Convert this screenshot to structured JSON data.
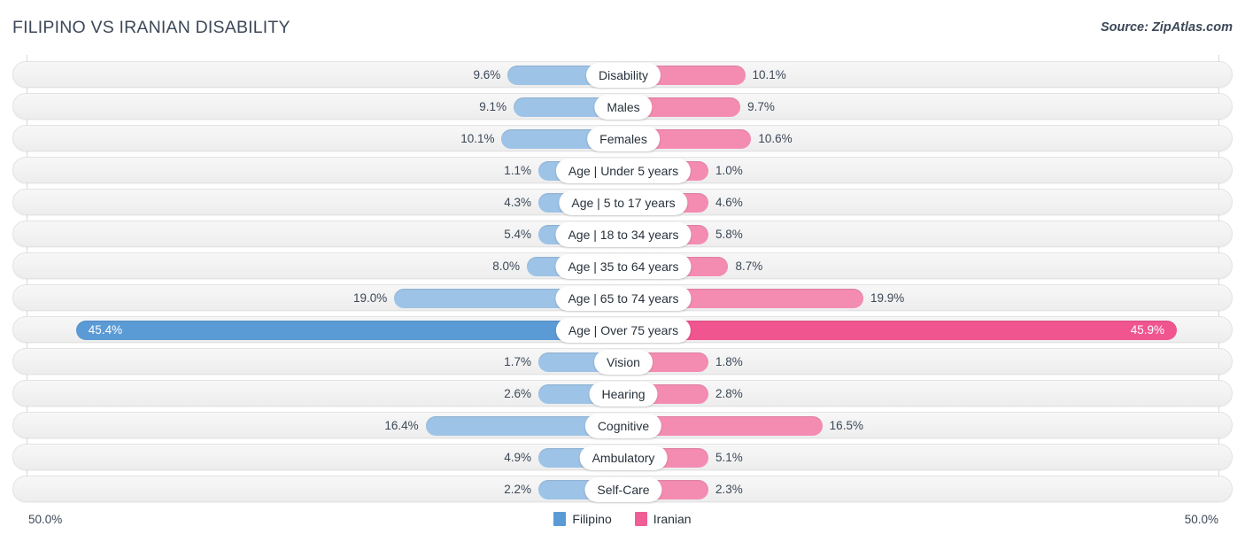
{
  "header": {
    "title": "FILIPINO VS IRANIAN DISABILITY",
    "source": "Source: ZipAtlas.com"
  },
  "footer": {
    "axis_left": "50.0%",
    "axis_right": "50.0%",
    "legend": [
      {
        "label": "Filipino",
        "color": "#5b9bd5"
      },
      {
        "label": "Iranian",
        "color": "#ef5f96"
      }
    ]
  },
  "colors": {
    "filipino": "#9dc3e6",
    "filipino_max": "#5b9bd5",
    "iranian": "#f48cb2",
    "iranian_max": "#f0558f",
    "row_bg": "#f2f2f2",
    "text": "#3c4858"
  },
  "chart_data": {
    "type": "bar",
    "title": "FILIPINO VS IRANIAN DISABILITY",
    "subtitle": "Source: ZipAtlas.com",
    "orientation": "horizontal-diverging",
    "xlabel": "",
    "ylabel": "",
    "xlim": [
      50.0,
      50.0
    ],
    "axis_left_label": "50.0%",
    "axis_right_label": "50.0%",
    "grid": true,
    "legend_position": "bottom-center",
    "categories": [
      "Disability",
      "Males",
      "Females",
      "Age | Under 5 years",
      "Age | 5 to 17 years",
      "Age | 18 to 34 years",
      "Age | 35 to 64 years",
      "Age | 65 to 74 years",
      "Age | Over 75 years",
      "Vision",
      "Hearing",
      "Cognitive",
      "Ambulatory",
      "Self-Care"
    ],
    "series": [
      {
        "name": "Filipino",
        "color": "#9dc3e6",
        "values": [
          9.6,
          9.1,
          10.1,
          1.1,
          4.3,
          5.4,
          8.0,
          19.0,
          45.4,
          1.7,
          2.6,
          16.4,
          4.9,
          2.2
        ],
        "labels": [
          "9.6%",
          "9.1%",
          "10.1%",
          "1.1%",
          "4.3%",
          "5.4%",
          "8.0%",
          "19.0%",
          "45.4%",
          "1.7%",
          "2.6%",
          "16.4%",
          "4.9%",
          "2.2%"
        ]
      },
      {
        "name": "Iranian",
        "color": "#f48cb2",
        "values": [
          10.1,
          9.7,
          10.6,
          1.0,
          4.6,
          5.8,
          8.7,
          19.9,
          45.9,
          1.8,
          2.8,
          16.5,
          5.1,
          2.3
        ],
        "labels": [
          "10.1%",
          "9.7%",
          "10.6%",
          "1.0%",
          "4.6%",
          "5.8%",
          "8.7%",
          "19.9%",
          "45.9%",
          "1.8%",
          "2.8%",
          "16.5%",
          "5.1%",
          "2.3%"
        ]
      }
    ]
  },
  "rows": [
    {
      "label": "Disability",
      "left_value": 9.6,
      "left_text": "9.6%",
      "right_value": 10.1,
      "right_text": "10.1%",
      "highlight": false
    },
    {
      "label": "Males",
      "left_value": 9.1,
      "left_text": "9.1%",
      "right_value": 9.7,
      "right_text": "9.7%",
      "highlight": false
    },
    {
      "label": "Females",
      "left_value": 10.1,
      "left_text": "10.1%",
      "right_value": 10.6,
      "right_text": "10.6%",
      "highlight": false
    },
    {
      "label": "Age | Under 5 years",
      "left_value": 1.1,
      "left_text": "1.1%",
      "right_value": 1.0,
      "right_text": "1.0%",
      "highlight": false
    },
    {
      "label": "Age | 5 to 17 years",
      "left_value": 4.3,
      "left_text": "4.3%",
      "right_value": 4.6,
      "right_text": "4.6%",
      "highlight": false
    },
    {
      "label": "Age | 18 to 34 years",
      "left_value": 5.4,
      "left_text": "5.4%",
      "right_value": 5.8,
      "right_text": "5.8%",
      "highlight": false
    },
    {
      "label": "Age | 35 to 64 years",
      "left_value": 8.0,
      "left_text": "8.0%",
      "right_value": 8.7,
      "right_text": "8.7%",
      "highlight": false
    },
    {
      "label": "Age | 65 to 74 years",
      "left_value": 19.0,
      "left_text": "19.0%",
      "right_value": 19.9,
      "right_text": "19.9%",
      "highlight": false
    },
    {
      "label": "Age | Over 75 years",
      "left_value": 45.4,
      "left_text": "45.4%",
      "right_value": 45.9,
      "right_text": "45.9%",
      "highlight": true
    },
    {
      "label": "Vision",
      "left_value": 1.7,
      "left_text": "1.7%",
      "right_value": 1.8,
      "right_text": "1.8%",
      "highlight": false
    },
    {
      "label": "Hearing",
      "left_value": 2.6,
      "left_text": "2.6%",
      "right_value": 2.8,
      "right_text": "2.8%",
      "highlight": false
    },
    {
      "label": "Cognitive",
      "left_value": 16.4,
      "left_text": "16.4%",
      "right_value": 16.5,
      "right_text": "16.5%",
      "highlight": false
    },
    {
      "label": "Ambulatory",
      "left_value": 4.9,
      "left_text": "4.9%",
      "right_value": 5.1,
      "right_text": "5.1%",
      "highlight": false
    },
    {
      "label": "Self-Care",
      "left_value": 2.2,
      "left_text": "2.2%",
      "right_value": 2.3,
      "right_text": "2.3%",
      "highlight": false
    }
  ]
}
